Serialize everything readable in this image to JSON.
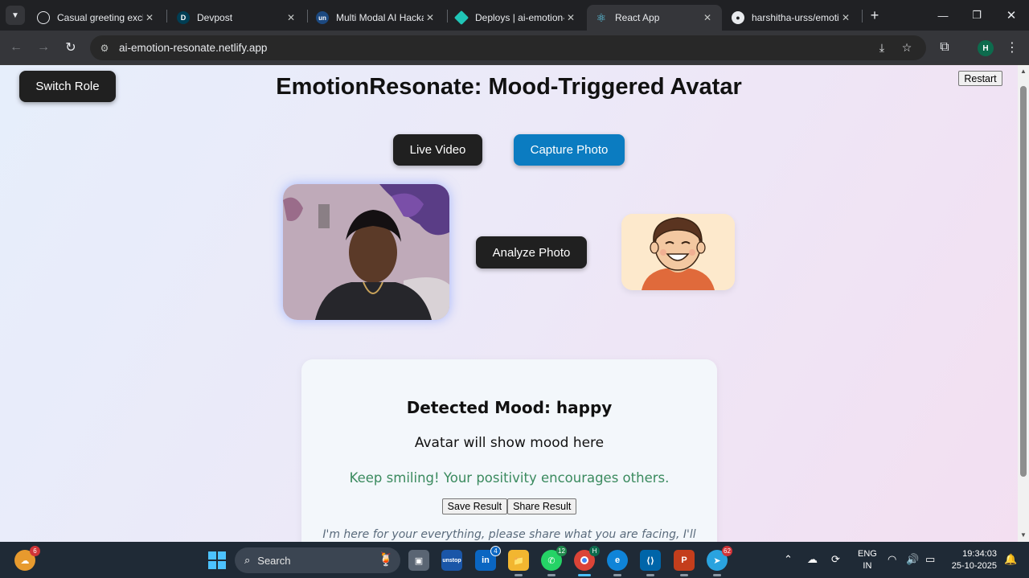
{
  "browser": {
    "tabs": [
      {
        "title": "Casual greeting exchange",
        "favicon": "openai-icon",
        "active": false
      },
      {
        "title": "Devpost",
        "favicon": "devpost-icon",
        "active": false
      },
      {
        "title": "Multi Modal AI Hackathon",
        "favicon": "unstop-icon",
        "active": false
      },
      {
        "title": "Deploys | ai-emotion-resonate",
        "favicon": "netlify-icon",
        "active": false
      },
      {
        "title": "React App",
        "favicon": "react-icon",
        "active": true
      },
      {
        "title": "harshitha-urss/emotion",
        "favicon": "github-icon",
        "active": false
      }
    ],
    "url": "ai-emotion-resonate.netlify.app",
    "profile_initial": "H"
  },
  "page": {
    "switch_role_label": "Switch Role",
    "restart_label": "Restart",
    "title": "EmotionResonate: Mood-Triggered Avatar",
    "live_video_label": "Live Video",
    "capture_photo_label": "Capture Photo",
    "analyze_photo_label": "Analyze Photo",
    "result": {
      "detected_mood": "Detected Mood: happy",
      "avatar_note": "Avatar will show mood here",
      "advice": "Keep smiling! Your positivity encourages others.",
      "save_label": "Save Result",
      "share_label": "Share Result",
      "support_message": "I'm here for your everything, please share what you are facing, I'll"
    }
  },
  "taskbar": {
    "search_label": "Search",
    "badges": {
      "weather": "6",
      "linkedin": "4",
      "whatsapp": "12",
      "telegram": "62"
    },
    "chrome_profile": "H",
    "language": "ENG",
    "region": "IN",
    "time": "19:34:03",
    "date": "25-10-2025"
  },
  "colors": {
    "capture_button": "#0b7cc1",
    "dark_button": "#202020",
    "advice_text": "#3a8a5e"
  }
}
